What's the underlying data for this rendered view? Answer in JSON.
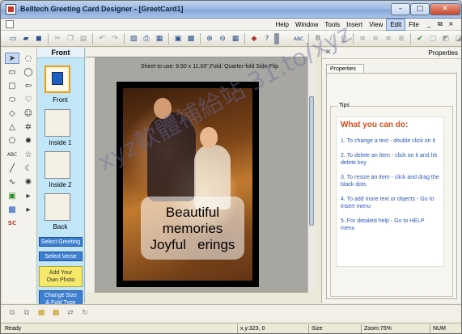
{
  "window": {
    "title": "Belltech Greeting Card Designer - [GreetCard1]",
    "controls": {
      "minimize": "–",
      "maximize": "□",
      "close": "✕"
    }
  },
  "menubar": {
    "items": [
      "Help",
      "Window",
      "Tools",
      "Insert",
      "View",
      "Edit",
      "File"
    ],
    "active": "Edit",
    "doc_controls": [
      "_",
      "⧉",
      "×"
    ]
  },
  "toolbar": {
    "left_icons": [
      "new-icon",
      "open-icon",
      "save-icon",
      "cut-icon",
      "copy-icon",
      "paste-icon",
      "undo-icon",
      "redo-icon",
      "preview-icon",
      "print-icon",
      "page-setup-icon",
      "layout-icon",
      "zoom-in-icon",
      "zoom-out-icon",
      "grid-icon",
      "book-icon",
      "card-icon"
    ],
    "right_icons": [
      "spellcheck-icon",
      "bold-icon",
      "italic-icon",
      "underline-icon",
      "align-left-icon",
      "align-center-icon",
      "align-right-icon",
      "justify-icon",
      "check-icon",
      "lock-icon",
      "color-icon"
    ]
  },
  "palette": {
    "tools": [
      "pointer-icon",
      "callout-icon",
      "rectangle-icon",
      "speech-bubble-icon",
      "rounded-rect-icon",
      "arrow-callout-icon",
      "ellipse-icon",
      "smiley-icon",
      "diamond-icon",
      "heart-icon",
      "triangle-icon",
      "gear-icon",
      "polygon-icon",
      "sun-icon",
      "star-icon",
      "text-icon",
      "moon-icon",
      "line-icon",
      "burst-icon",
      "curve-icon",
      "image-icon",
      "clipart-icon"
    ]
  },
  "pages": {
    "header": "Front",
    "thumbs": [
      {
        "label": "Front"
      },
      {
        "label": "Inside 1"
      },
      {
        "label": "Inside 2"
      },
      {
        "label": "Back"
      }
    ],
    "buttons": {
      "select_greeting": "Select Greeting",
      "select_verse": "Select Verse",
      "add_photo_line1": "Add Your",
      "add_photo_line2": "Own Photo",
      "change_size_line1": "Change Size",
      "change_size_line2": "& Fold Type"
    }
  },
  "canvas": {
    "hint": "Sheet to use: 8.50 x 11.00\",Fold: Quarter-fold Side-Flip",
    "card_text": [
      "Beautiful",
      "memories",
      "Joyful   erings"
    ]
  },
  "right_panel": {
    "title": "Properties",
    "tab": "Properties",
    "tips_legend": "Tips",
    "tips_title": "What you can do:",
    "tips": [
      "1. To change a text - double click on it",
      "2. To delete an item - click on it and hit delete key",
      "3. To resize an item - click and drag the black dots",
      "4. To add more text or objects - Go to Insert menu",
      "5. For detailed help - Go to HELP menu"
    ]
  },
  "status": {
    "ready": "Ready",
    "coords": "x,y:323, 0",
    "size": "Size",
    "zoom": "Zoom:75%",
    "num": "NUM"
  },
  "watermark": "xyz軟體補給站 31.to/xyz"
}
